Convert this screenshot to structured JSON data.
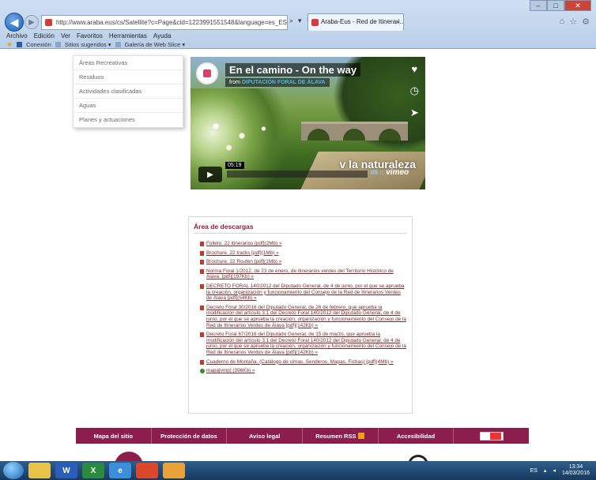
{
  "browser": {
    "address_url": "http://www.araba.eus/cs/Satellite?c=Page&cid=1223991551548&language=es_ES&pagename",
    "address_tools": [
      "⌕",
      "▾",
      "↻"
    ],
    "tab_title": "Araba-Eus - Red de Itinerari...",
    "tab_close": "×",
    "window_buttons": [
      "–",
      "□",
      "✕"
    ],
    "right_icons": [
      "⌂",
      "☆",
      "⚙"
    ],
    "menu": [
      "Archivo",
      "Edición",
      "Ver",
      "Favoritos",
      "Herramientas",
      "Ayuda"
    ],
    "favorites": [
      "Conexión",
      "Sitios sugeridos ▾",
      "Galería de Web Slice ▾"
    ]
  },
  "sidebar": {
    "items": [
      {
        "label": "Áreas Recreativas"
      },
      {
        "label": "Residuos"
      },
      {
        "label": "Actividades clasificadas"
      },
      {
        "label": "Aguas"
      },
      {
        "label": "Planes y actuaciones"
      }
    ]
  },
  "video": {
    "title": "En el camino - On the way",
    "from_prefix": "from",
    "from_author": "DIPUTACIÓN FORAL DE ÁLAVA",
    "overlay_text": "v la naturaleza",
    "time": "05:19",
    "brand": "vimeo",
    "brand_bars": "IIII ::",
    "icons": {
      "like": "heart-icon",
      "later": "clock-icon",
      "share": "paper-plane-icon"
    }
  },
  "downloads": {
    "title": "Área de descargas",
    "items": [
      {
        "text": "Folleto. 22 itinerarios [pdf](2Mb) »",
        "icon": "pdf"
      },
      {
        "text": "Brochure. 22 tracks [pdf](1Mb) »",
        "icon": "pdf"
      },
      {
        "text": "Brochure. 22 Routen [pdf](1Mb) »",
        "icon": "pdf"
      },
      {
        "text": "Norma Foral 1/2012, de 23 de enero, de itinerarios verdes del Territorio Histórico de Álava. [pdf](197Kb) »",
        "icon": "pdf"
      },
      {
        "text": "DECRETO FORAL 140/2012 del Diputado General, de 4 de junio, por el que se aprueba la creación, organización y funcionamiento del Consejo de la Red de Itinerarios Verdes de Álava [pdf](54Kb) »",
        "icon": "pdf"
      },
      {
        "text": "Decreto Foral 30/2016 del Diputado General, de 26 de febrero, que aprueba la modificación del artículo 3.1 del Decreto Foral 140/2012 del Diputado General, de 4 de junio, por el que se aprueba la creación, organización y funcionamiento del Consejo de la Red de Itinerarios Verdes de Álava [pdf](142Kb) »",
        "icon": "pdf"
      },
      {
        "text": "Decreto Foral 67/2016 del Diputado General, de 15 de marzo, que aprueba la modificación del artículo 3.1 del Decreto Foral 140/2012 del Diputado General, de 4 de junio, por el que se aprueba la creación, organización y funcionamiento del Consejo de la Red de Itinerarios Verdes de Álava [pdf](142Kb) »",
        "icon": "pdf"
      },
      {
        "text": "Cuaderno de Montaña. (Catálogo de cimas, Senderos, Mapas, Fichas) [pdf](4Mb) »",
        "icon": "pdf"
      },
      {
        "text": "mapa[vmp] (396Kb) »",
        "icon": "map"
      }
    ]
  },
  "footer": {
    "links": [
      "Mapa del sitio",
      "Protección de datos",
      "Aviso legal",
      "Resumen RSS",
      "Accesibilidad"
    ]
  },
  "taskbar": {
    "apps": [
      {
        "label": "",
        "color": "#e8c24a"
      },
      {
        "label": "W",
        "color": "#2b5eb8"
      },
      {
        "label": "X",
        "color": "#2a8a3e"
      },
      {
        "label": "e",
        "color": "#3b8fd8"
      },
      {
        "label": "",
        "color": "#d9482b"
      },
      {
        "label": "",
        "color": "#e7a33a"
      }
    ],
    "lang": "ES",
    "time": "13:34",
    "date": "14/03/2016"
  },
  "colors": {
    "brand": "#8b1e4c",
    "link": "#7a2a2a",
    "heading": "#8b1d3c"
  }
}
